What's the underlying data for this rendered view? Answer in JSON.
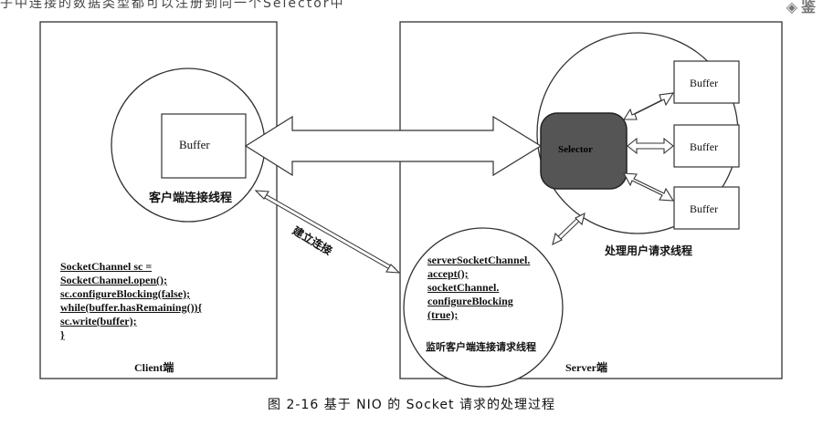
{
  "top_fragment": "子中连接的数据类型都可以注册到同一个Selector中",
  "corner_fragment": "◈ 鉴",
  "client": {
    "buffer_label": "Buffer",
    "thread_label": "客户端连接线程",
    "code_lines": [
      "SocketChannel sc =",
      "SocketChannel.open();",
      "sc.configureBlocking(false);",
      "while(buffer.hasRemaining()){",
      "sc.write(buffer);",
      "}"
    ],
    "footer_label": "Client端"
  },
  "connect_label": "建立连接",
  "server": {
    "selector_label": "Selector",
    "buffers": [
      "Buffer",
      "Buffer",
      "Buffer"
    ],
    "handler_label": "处理用户请求线程",
    "listener_code_lines": [
      "serverSocketChannel.",
      "accept();",
      "socketChannel.",
      "configureBlocking",
      "(true);"
    ],
    "listener_label": "监听客户端连接请求线程",
    "footer_label": "Server端"
  },
  "caption": "图 2-16   基于 NIO 的 Socket 请求的处理过程"
}
